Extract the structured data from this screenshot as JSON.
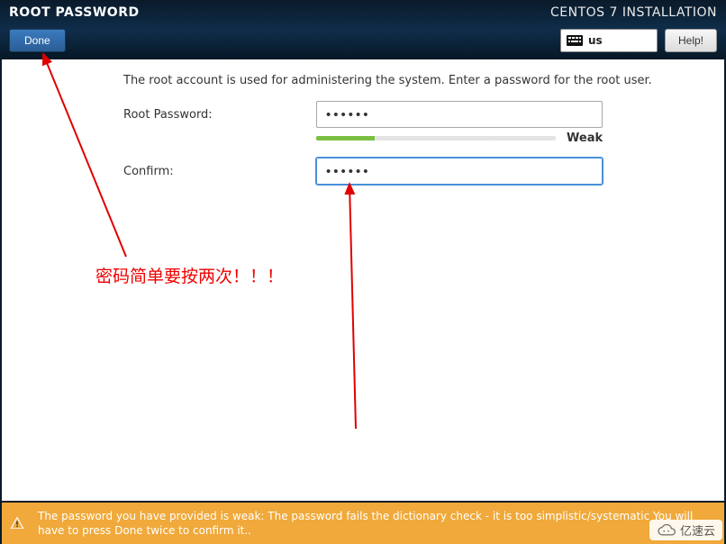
{
  "header": {
    "page_title": "ROOT PASSWORD",
    "install_title": "CENTOS 7 INSTALLATION",
    "done_label": "Done",
    "keyboard_layout": "us",
    "help_label": "Help!"
  },
  "form": {
    "instruction": "The root account is used for administering the system.  Enter a password for the root user.",
    "password_label": "Root Password:",
    "password_value": "••••••",
    "confirm_label": "Confirm:",
    "confirm_value": "••••••",
    "strength_label": "Weak",
    "strength_segments_filled": 1,
    "strength_segments_total": 4
  },
  "annotation": {
    "note_text": "密码简单要按两次！！！",
    "arrow_color": "#e00000"
  },
  "footer": {
    "warning_text": "The password you have provided is weak: The password fails the dictionary check - it is too simplistic/systematic You will have to press Done twice to confirm it.."
  },
  "watermark": {
    "text": "亿速云"
  }
}
